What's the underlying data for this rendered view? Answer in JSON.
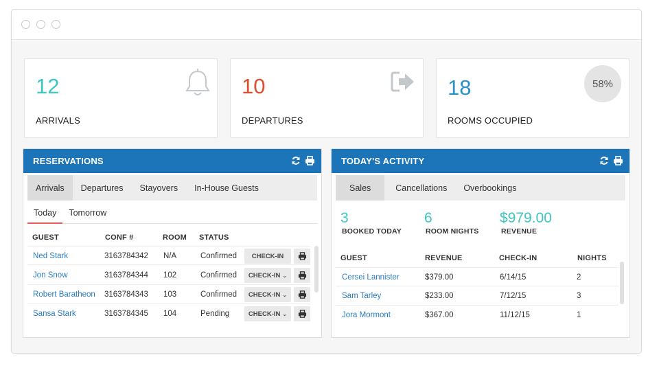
{
  "colors": {
    "arrivals": "#3dc6c0",
    "departures": "#e04e2f",
    "rooms": "#2a90c8",
    "panel_header": "#1d75b9",
    "link": "#2a7dc1",
    "teal": "#3dc6c0"
  },
  "stats": {
    "arrivals": {
      "value": "12",
      "label": "ARRIVALS",
      "icon": "bell-icon"
    },
    "departures": {
      "value": "10",
      "label": "DEPARTURES",
      "icon": "sign-out-icon"
    },
    "rooms": {
      "value": "18",
      "label": "ROOMS OCCUPIED",
      "percent": "58%",
      "percent_value": 58
    }
  },
  "reservations": {
    "title": "RESERVATIONS",
    "tools": [
      "refresh-icon",
      "print-icon"
    ],
    "tabs": [
      "Arrivals",
      "Departures",
      "Stayovers",
      "In-House Guests"
    ],
    "active_tab": "Arrivals",
    "subtabs": [
      "Today",
      "Tomorrow"
    ],
    "active_subtab": "Today",
    "columns": [
      "GUEST",
      "CONF #",
      "ROOM",
      "STATUS"
    ],
    "rows": [
      {
        "guest": "Ned Stark",
        "conf": "3163784342",
        "room": "N/A",
        "status": "Confirmed",
        "action": "CHECK-IN",
        "dropdown": false
      },
      {
        "guest": "Jon Snow",
        "conf": "3163784344",
        "room": "102",
        "status": "Confirmed",
        "action": "CHECK-IN",
        "dropdown": true
      },
      {
        "guest": "Robert Baratheon",
        "conf": "3163784343",
        "room": "103",
        "status": "Confirmed",
        "action": "CHECK-IN",
        "dropdown": true
      },
      {
        "guest": "Sansa Stark",
        "conf": "3163784345",
        "room": "104",
        "status": "Pending",
        "action": "CHECK-IN",
        "dropdown": true
      }
    ]
  },
  "activity": {
    "title": "TODAY'S ACTIVITY",
    "tools": [
      "refresh-icon",
      "print-icon"
    ],
    "tabs": [
      "Sales",
      "Cancellations",
      "Overbookings"
    ],
    "active_tab": "Sales",
    "metrics": [
      {
        "value": "3",
        "label": "BOOKED TODAY"
      },
      {
        "value": "6",
        "label": "ROOM NIGHTS"
      },
      {
        "value": "$979.00",
        "label": "REVENUE"
      }
    ],
    "columns": [
      "GUEST",
      "REVENUE",
      "CHECK-IN",
      "NIGHTS"
    ],
    "rows": [
      {
        "guest": "Cersei Lannister",
        "revenue": "$379.00",
        "checkin": "6/14/15",
        "nights": "2"
      },
      {
        "guest": "Sam Tarley",
        "revenue": "$233.00",
        "checkin": "7/12/15",
        "nights": "3"
      },
      {
        "guest": "Jora Mormont",
        "revenue": "$367.00",
        "checkin": "11/12/15",
        "nights": "1"
      }
    ]
  }
}
